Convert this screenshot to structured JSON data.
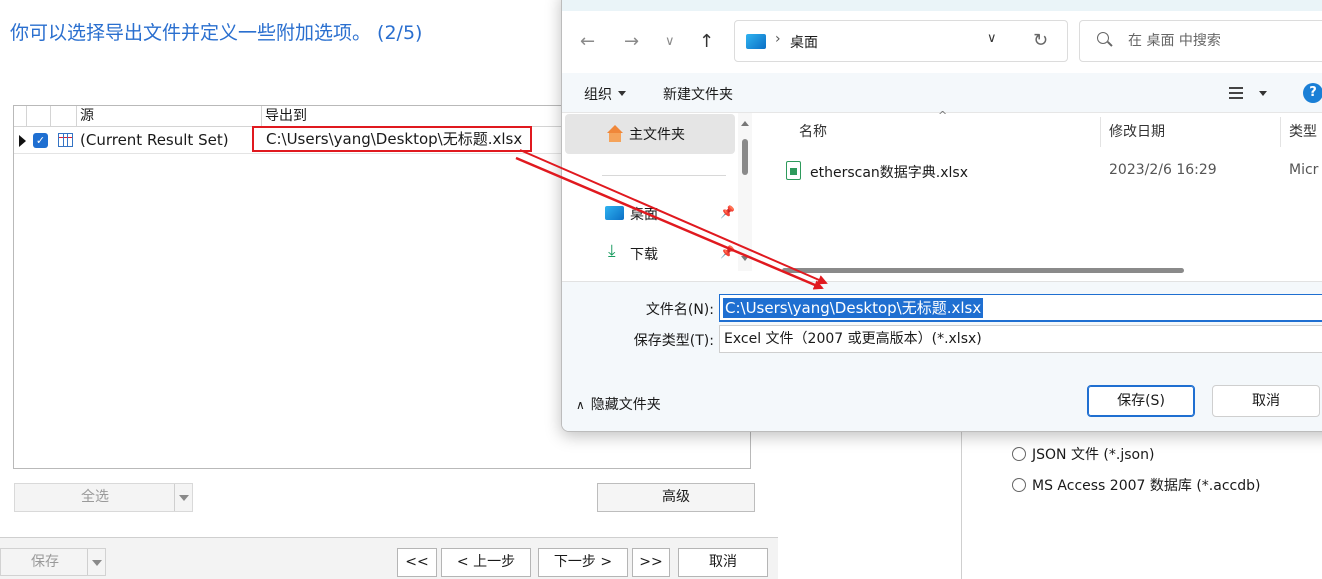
{
  "wizard": {
    "title": "你可以选择导出文件并定义一些附加选项。 (2/5)",
    "grid": {
      "headers": [
        "源",
        "导出到"
      ],
      "rows": [
        {
          "source": "(Current Result Set)",
          "destination": "C:\\Users\\yang\\Desktop\\无标题.xlsx",
          "checked": true
        }
      ]
    },
    "select_all_label": "全选",
    "advanced_label": "高级",
    "save_label": "保存",
    "nav": {
      "first": "<<",
      "prev": "< 上一步",
      "next": "下一步 >",
      "last": ">>",
      "cancel": "取消"
    },
    "format_options": [
      {
        "label": "JSON 文件 (*.json)"
      },
      {
        "label": "MS Access 2007 数据库 (*.accdb)"
      }
    ]
  },
  "dialog": {
    "address": {
      "current": "桌面"
    },
    "search": {
      "placeholder": "在 桌面 中搜索"
    },
    "toolbar": {
      "organize": "组织",
      "new_folder": "新建文件夹",
      "help": "?"
    },
    "nav_pane": {
      "home": "主文件夹",
      "desktop": "桌面",
      "downloads": "下载"
    },
    "file_list": {
      "columns": [
        "名称",
        "修改日期",
        "类型"
      ],
      "files": [
        {
          "name": "etherscan数据字典.xlsx",
          "modified": "2023/2/6 16:29",
          "type": "Micr"
        }
      ]
    },
    "form": {
      "filename_label": "文件名(N):",
      "filename_value": "C:\\Users\\yang\\Desktop\\无标题.xlsx",
      "filetype_label": "保存类型(T):",
      "filetype_value": "Excel 文件（2007 或更高版本）(*.xlsx)"
    },
    "hide_folders": "隐藏文件夹",
    "save_button": "保存(S)",
    "cancel_button": "取消"
  },
  "colors": {
    "accent": "#1f6fd1",
    "title_blue": "#2a6fcf",
    "annotation_red": "#e0191f"
  }
}
